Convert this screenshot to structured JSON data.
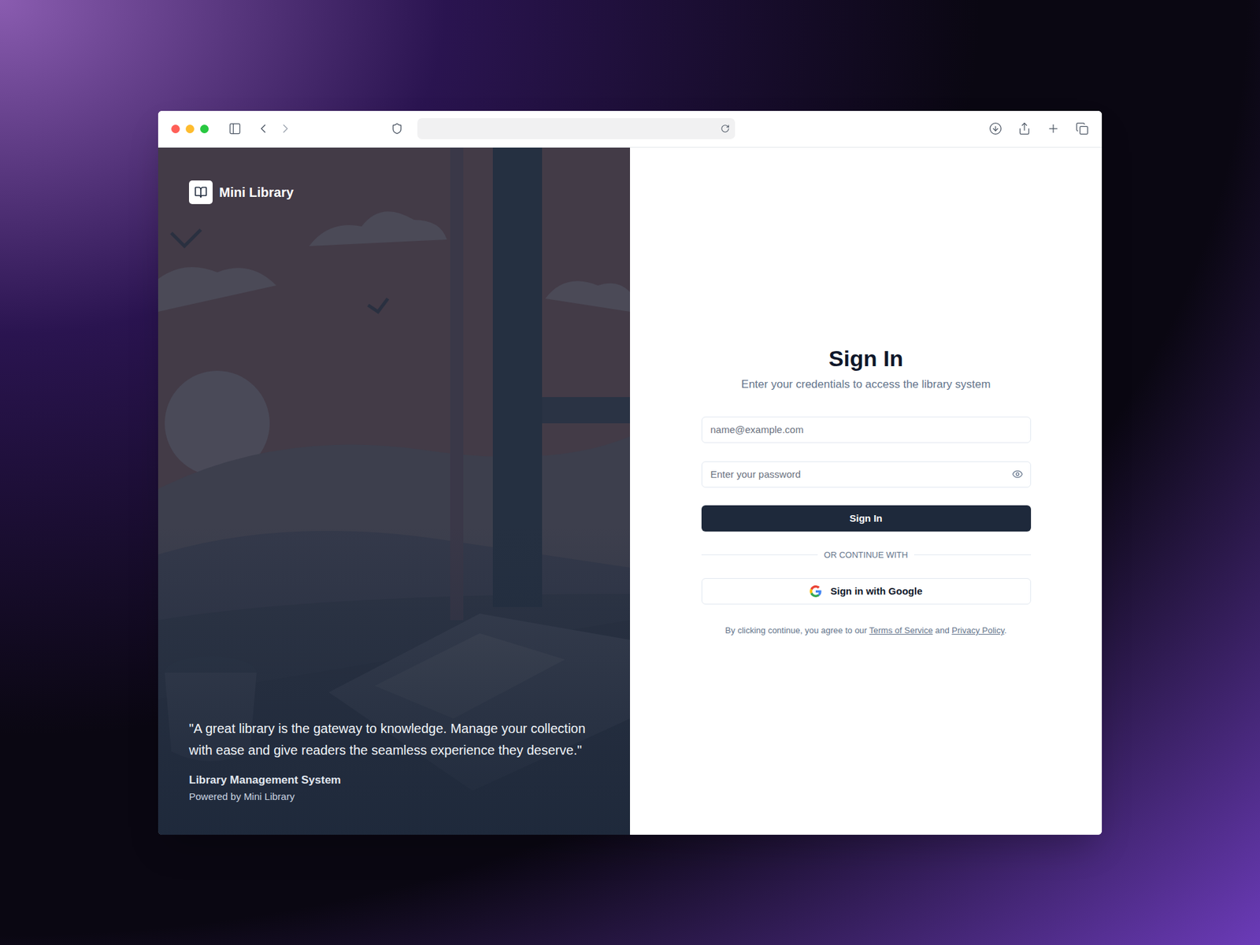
{
  "brand": {
    "name": "Mini Library"
  },
  "form": {
    "title": "Sign In",
    "subtitle": "Enter your credentials to access the library system",
    "email_placeholder": "name@example.com",
    "password_placeholder": "Enter your password",
    "submit": "Sign In",
    "divider": "OR CONTINUE WITH",
    "google_button": "Sign in with Google",
    "terms": {
      "prefix": "By clicking continue, you agree to our ",
      "terms_link": "Terms of Service",
      "middle": " and ",
      "privacy_link": "Privacy Policy",
      "suffix": "."
    }
  },
  "quote": {
    "text": "\"A great library is the gateway to knowledge. Manage your collection with ease and give readers the seamless experience they deserve.\"",
    "title": "Library Management System",
    "subtitle": "Powered by Mini Library"
  }
}
